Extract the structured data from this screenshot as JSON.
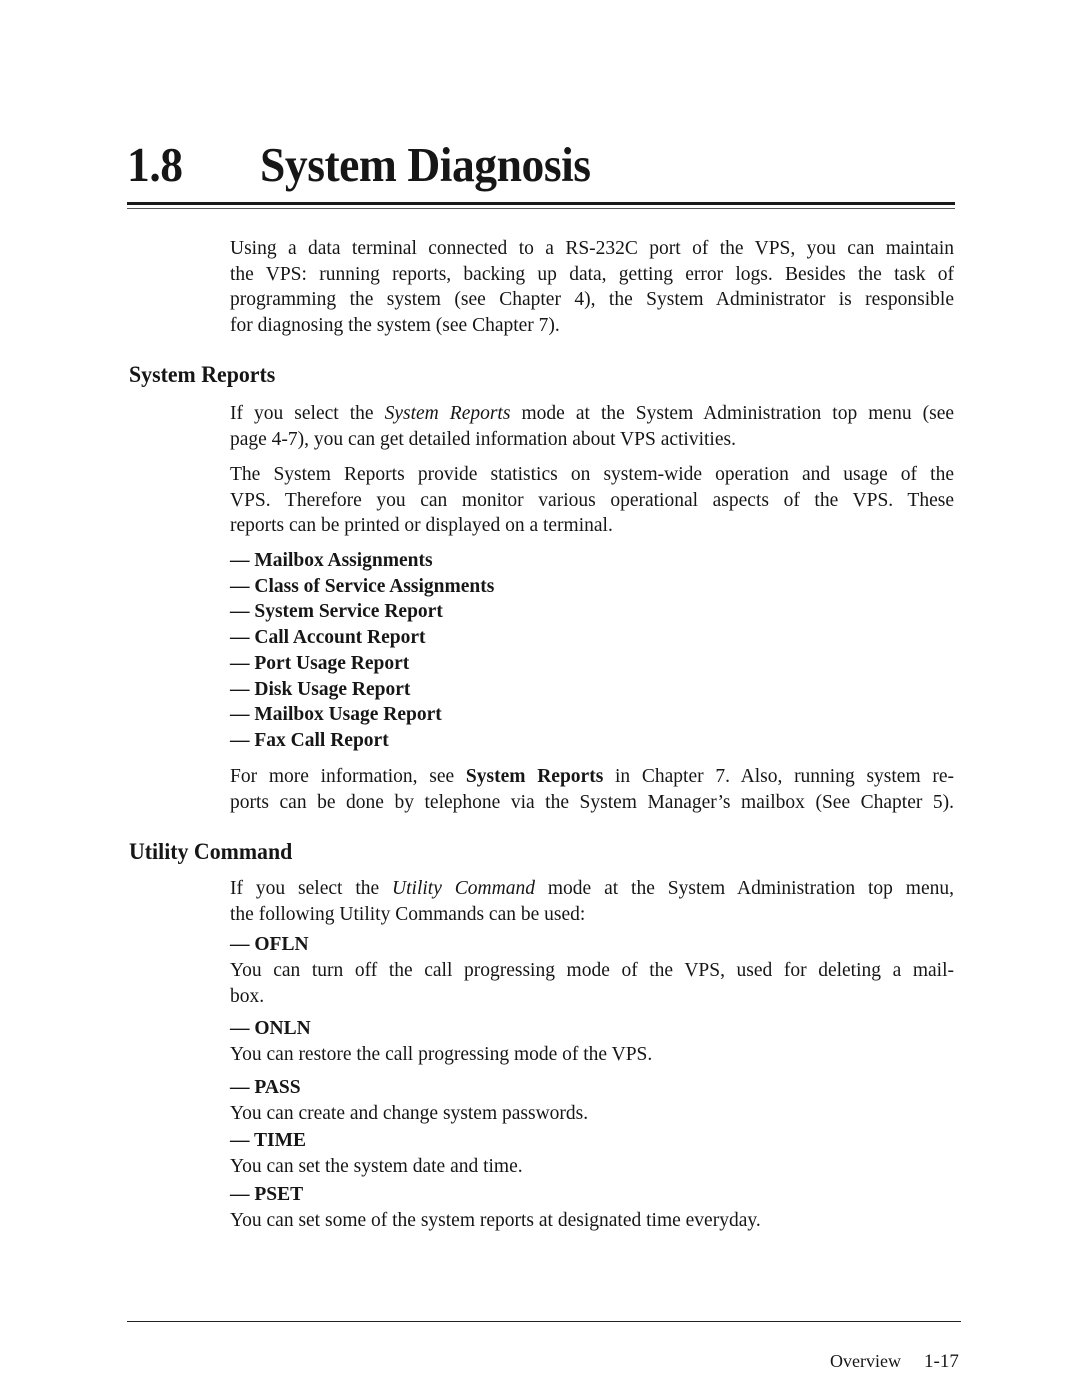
{
  "heading": {
    "number": "1.8",
    "title": "System Diagnosis"
  },
  "intro": {
    "lines": [
      "Using a data terminal connected to a RS-232C port of the VPS, you can maintain",
      "the VPS: running reports, backing up data, getting error logs.  Besides the task of",
      "programming the system (see Chapter 4), the System Administrator is responsible",
      "for diagnosing the system (see Chapter 7)."
    ]
  },
  "system_reports": {
    "title": "System Reports",
    "p1": {
      "line1_pre": "If you select the ",
      "line1_em": "System Reports",
      "line1_post": " mode at the System Administration top menu (see",
      "line2": "page 4-7), you can get detailed information about VPS activities."
    },
    "p2": {
      "lines": [
        "The System Reports provide statistics on system-wide operation and usage of the",
        "VPS.  Therefore you can monitor various operational aspects of the VPS.  These",
        "reports can be printed or displayed on a terminal."
      ]
    },
    "bullet": "—",
    "items": [
      "Mailbox Assignments",
      "Class of Service Assignments",
      "System Service Report",
      "Call Account Report",
      "Port Usage Report",
      "Disk Usage Report",
      "Mailbox Usage Report",
      "Fax Call Report"
    ],
    "p3": {
      "line1_pre": "For more information, see ",
      "line1_bold": "System Reports",
      "line1_post": " in Chapter 7.  Also, running system re-",
      "line2": "ports can be done by telephone via the System Manager’s mailbox (See Chapter 5)."
    }
  },
  "utility_command": {
    "title": "Utility Command",
    "p1": {
      "line1_pre": "If you select the ",
      "line1_em": "Utility Command",
      "line1_post": " mode at the System Administration top menu,",
      "line2": "the following Utility Commands can be used:"
    },
    "commands": [
      {
        "name": "— OFLN",
        "desc": [
          "You can turn off the call progressing mode of the VPS, used for deleting a mail-",
          "box."
        ]
      },
      {
        "name": "— ONLN",
        "desc": [
          "You can restore the call progressing mode of the VPS."
        ]
      },
      {
        "name": "— PASS",
        "desc": [
          "You can create and change system passwords."
        ]
      },
      {
        "name": "— TIME",
        "desc": [
          "You can set the system date and time."
        ]
      },
      {
        "name": "— PSET",
        "desc": [
          "You can set some of the system reports at designated time everyday."
        ]
      }
    ]
  },
  "footer": {
    "section": "Overview",
    "page": "1-17"
  }
}
